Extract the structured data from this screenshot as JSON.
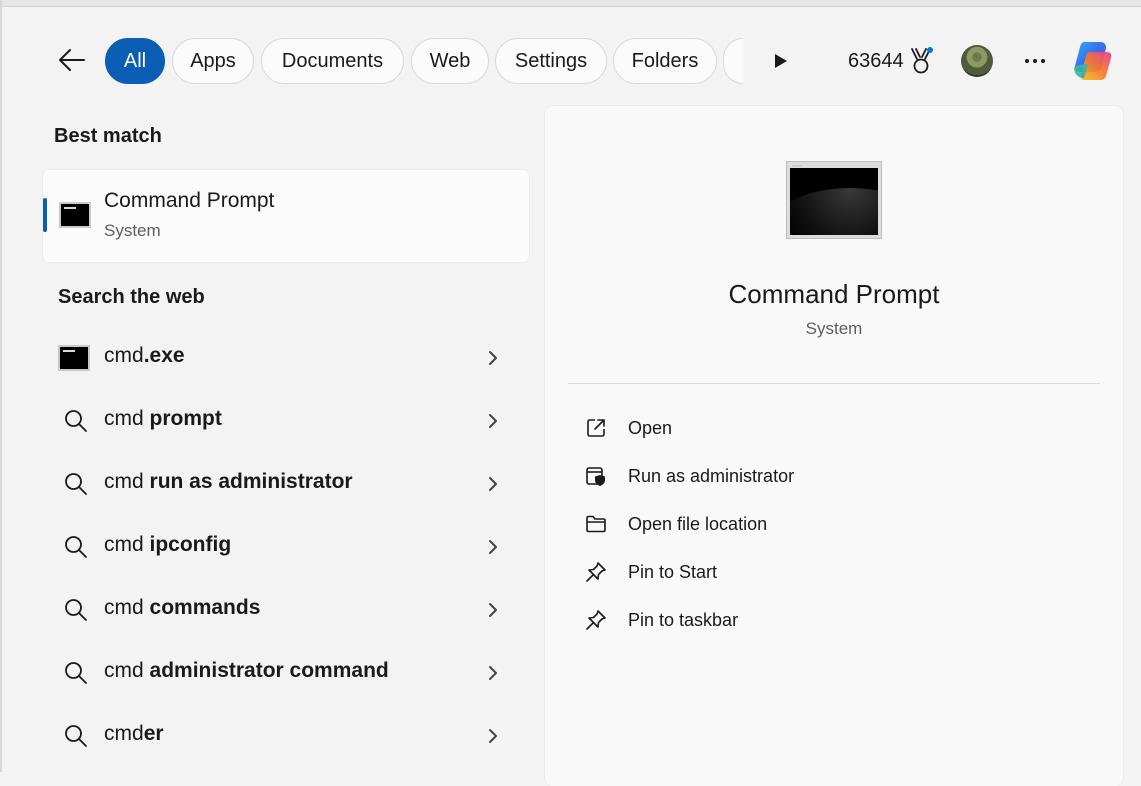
{
  "filter_bar": {
    "filters": [
      {
        "id": "all",
        "label": "All",
        "active": true
      },
      {
        "id": "apps",
        "label": "Apps",
        "active": false
      },
      {
        "id": "documents",
        "label": "Documents",
        "active": false
      },
      {
        "id": "web",
        "label": "Web",
        "active": false
      },
      {
        "id": "settings",
        "label": "Settings",
        "active": false
      },
      {
        "id": "folders",
        "label": "Folders",
        "active": false
      }
    ],
    "rewards_points": "63644",
    "icons": [
      "back-arrow-icon",
      "play-icon",
      "rewards-medal-icon",
      "more-icon",
      "copilot-icon"
    ]
  },
  "best_match": {
    "heading": "Best match",
    "title": "Command Prompt",
    "subtitle": "System",
    "icon": "command-prompt-icon"
  },
  "web": {
    "heading": "Search the web",
    "results": [
      {
        "prefix": "cmd",
        "suffix": ".exe",
        "icon": "command-prompt-icon"
      },
      {
        "prefix": "cmd ",
        "suffix": "prompt",
        "icon": "search-icon"
      },
      {
        "prefix": "cmd ",
        "suffix": "run as administrator",
        "icon": "search-icon"
      },
      {
        "prefix": "cmd ",
        "suffix": "ipconfig",
        "icon": "search-icon"
      },
      {
        "prefix": "cmd ",
        "suffix": "commands",
        "icon": "search-icon"
      },
      {
        "prefix": "cmd ",
        "suffix": "administrator command",
        "icon": "search-icon"
      },
      {
        "prefix": "cmd",
        "suffix": "er",
        "icon": "search-icon"
      }
    ]
  },
  "detail": {
    "title": "Command Prompt",
    "subtitle": "System",
    "actions": [
      {
        "label": "Open",
        "icon": "open-external-icon"
      },
      {
        "label": "Run as administrator",
        "icon": "shield-window-icon"
      },
      {
        "label": "Open file location",
        "icon": "folder-icon"
      },
      {
        "label": "Pin to Start",
        "icon": "pin-icon"
      },
      {
        "label": "Pin to taskbar",
        "icon": "pin-icon"
      }
    ]
  },
  "colors": {
    "accent": "#0a5fb4",
    "background": "#f3f3f3",
    "card": "#fbfbfb"
  }
}
